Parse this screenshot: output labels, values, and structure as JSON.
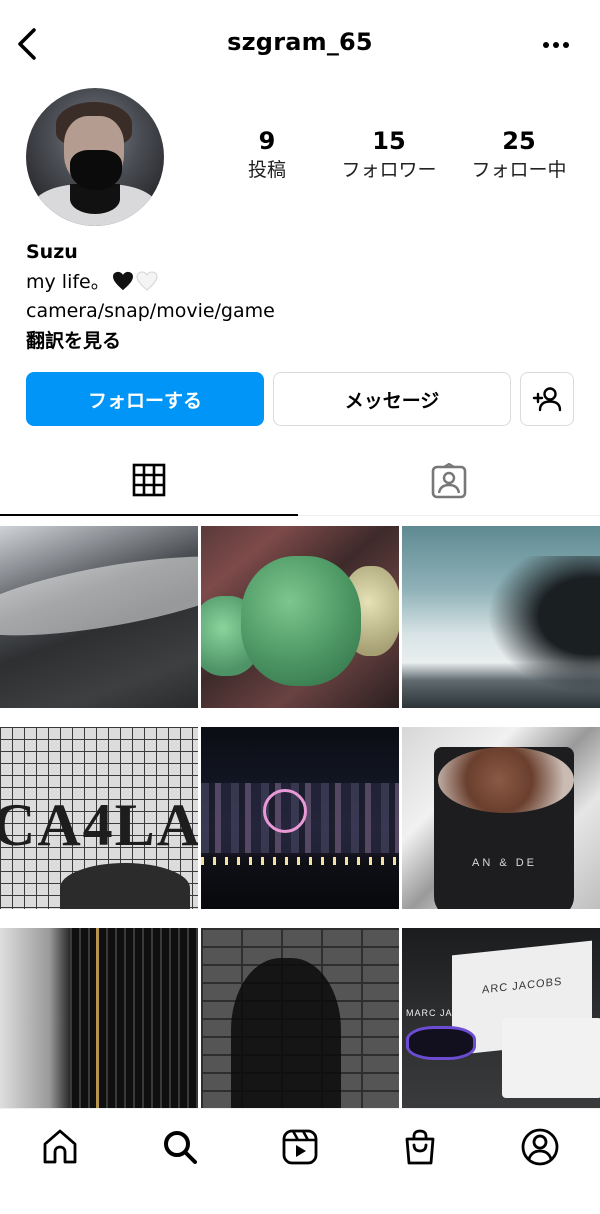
{
  "header": {
    "username": "szgram_65",
    "back_icon": "chevron-left-icon",
    "more_icon": "more-horizontal-icon"
  },
  "stats": [
    {
      "count": "9",
      "label": "投稿"
    },
    {
      "count": "15",
      "label": "フォロワー"
    },
    {
      "count": "25",
      "label": "フォロー中"
    }
  ],
  "bio": {
    "name": "Suzu",
    "line1": "my life。",
    "line2": "camera/snap/movie/game",
    "translate": "翻訳を見る"
  },
  "actions": {
    "follow": "フォローする",
    "message": "メッセージ",
    "add_user_icon": "add-user-icon"
  },
  "tabs": {
    "grid_icon": "grid-icon",
    "tagged_icon": "tagged-icon"
  },
  "posts": {
    "cell6_text": "AN & DE",
    "cell9_bag_text": "ARC JACOBS",
    "cell9_case_text": "MARC JACOBS",
    "cell4_text": "CA4LA"
  },
  "bottom_nav": [
    "home-icon",
    "search-icon",
    "reels-icon",
    "shop-icon",
    "profile-icon"
  ],
  "colors": {
    "accent": "#0095f6",
    "border": "#dbdbdb"
  }
}
